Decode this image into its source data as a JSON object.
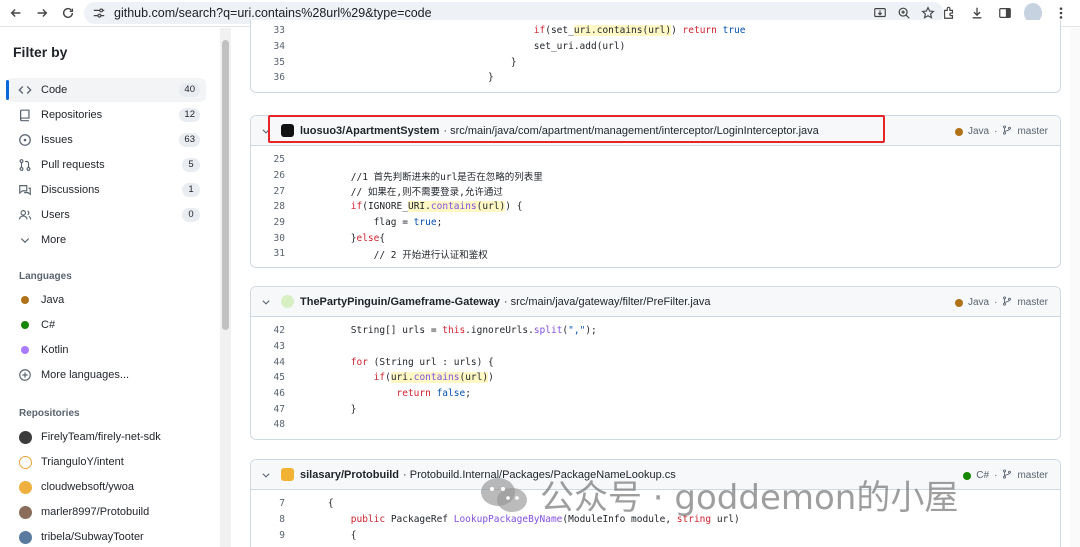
{
  "browser": {
    "url": "github.com/search?q=uri.contains%28url%29&type=code"
  },
  "sidebar": {
    "title": "Filter by",
    "types": [
      {
        "label": "Code",
        "count": "40",
        "icon": "code-icon",
        "active": true
      },
      {
        "label": "Repositories",
        "count": "12",
        "icon": "repo-icon"
      },
      {
        "label": "Issues",
        "count": "63",
        "icon": "issue-icon"
      },
      {
        "label": "Pull requests",
        "count": "5",
        "icon": "pull-request-icon"
      },
      {
        "label": "Discussions",
        "count": "1",
        "icon": "discussion-icon"
      },
      {
        "label": "Users",
        "count": "0",
        "icon": "users-icon"
      },
      {
        "label": "More",
        "count": "",
        "icon": "chevron-down-icon"
      }
    ],
    "languages_title": "Languages",
    "languages": [
      {
        "label": "Java",
        "color": "#b07219"
      },
      {
        "label": "C#",
        "color": "#178600"
      },
      {
        "label": "Kotlin",
        "color": "#a97bff"
      }
    ],
    "more_languages": "More languages...",
    "repositories_title": "Repositories",
    "repositories": [
      {
        "label": "FirelyTeam/firely-net-sdk",
        "color": "#3b3b3b"
      },
      {
        "label": "TrianguloY/intent",
        "color": "#e8a23a"
      },
      {
        "label": "cloudwebsoft/ywoa",
        "color": "#f0b040"
      },
      {
        "label": "marler8997/Protobuild",
        "color": "#8a6d5a"
      },
      {
        "label": "tribela/SubwayTooter",
        "color": "#5a7aa0"
      }
    ]
  },
  "results": [
    {
      "id": "partial",
      "lines": [
        {
          "n": "33",
          "t": "                                        if(set_uri.contains(url)) return true"
        },
        {
          "n": "34",
          "t": "                                        set_uri.add(url)"
        },
        {
          "n": "35",
          "t": "                                    }"
        },
        {
          "n": "36",
          "t": "                                }"
        }
      ]
    },
    {
      "repo": "luosuo3/ApartmentSystem",
      "path": "· src/main/java/com/apartment/management/interceptor/LoginInterceptor.java",
      "lang": "Java",
      "lang_color": "#b07219",
      "branch": "master",
      "lines": [
        {
          "n": "25",
          "t": ""
        },
        {
          "n": "26",
          "t": "        //1 首先判断进来的url是否在忽略的列表里"
        },
        {
          "n": "27",
          "t": "        // 如果在,则不需要登录,允许通过"
        },
        {
          "n": "28",
          "t": "        if(IGNORE_URI.contains(url)) {"
        },
        {
          "n": "29",
          "t": "            flag = true;"
        },
        {
          "n": "30",
          "t": "        }else{"
        },
        {
          "n": "31",
          "t": "            // 2 开始进行认证和鉴权"
        }
      ]
    },
    {
      "repo": "ThePartyPinguin/Gameframe-Gateway",
      "path": "· src/main/java/gateway/filter/PreFilter.java",
      "lang": "Java",
      "lang_color": "#b07219",
      "branch": "master",
      "lines": [
        {
          "n": "42",
          "t": "        String[] urls = this.ignoreUrls.split(\",\");"
        },
        {
          "n": "43",
          "t": ""
        },
        {
          "n": "44",
          "t": "        for (String url : urls) {"
        },
        {
          "n": "45",
          "t": "            if(uri.contains(url))"
        },
        {
          "n": "46",
          "t": "                return false;"
        },
        {
          "n": "47",
          "t": "        }"
        },
        {
          "n": "48",
          "t": ""
        }
      ]
    },
    {
      "repo": "silasary/Protobuild",
      "path": "· Protobuild.Internal/Packages/PackageNameLookup.cs",
      "lang": "C#",
      "lang_color": "#178600",
      "branch": "master",
      "lines": [
        {
          "n": "7",
          "t": "    {"
        },
        {
          "n": "8",
          "t": "        public PackageRef LookupPackageByName(ModuleInfo module, string url)"
        },
        {
          "n": "9",
          "t": "        {"
        }
      ]
    }
  ],
  "watermark": {
    "text": "公众号 · goddemon的小屋"
  }
}
